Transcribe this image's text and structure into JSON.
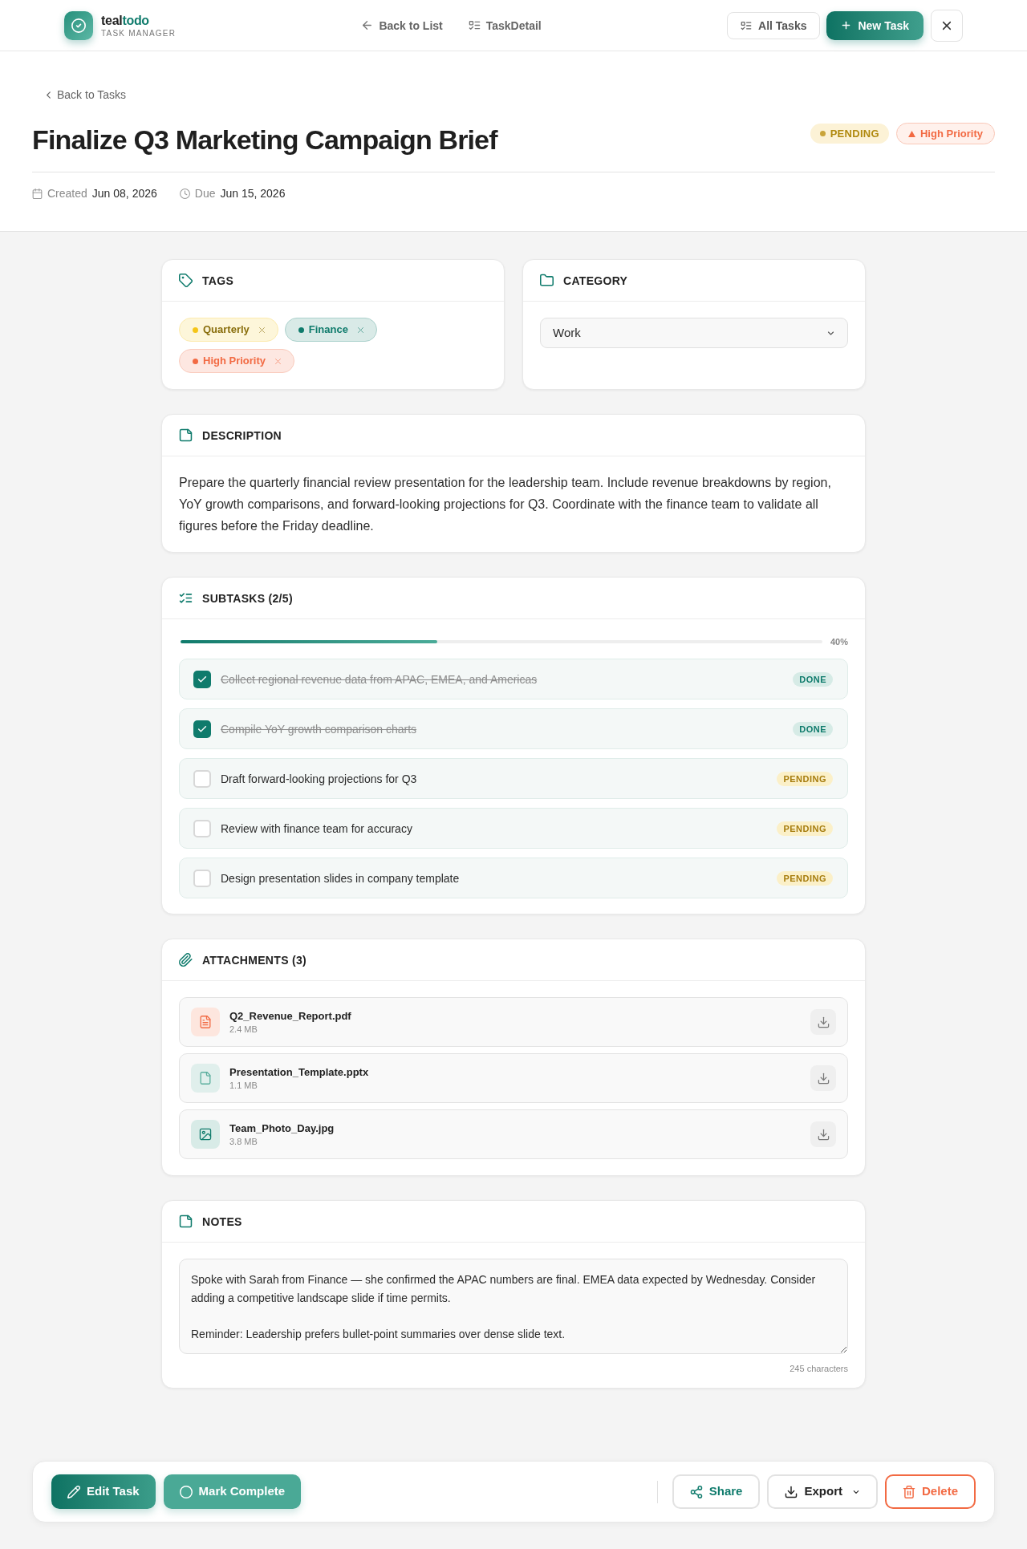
{
  "header": {
    "brand": {
      "name_start": "teal",
      "name_end": "todo",
      "subtitle": "TASK MANAGER"
    },
    "nav": [
      {
        "kind": "back",
        "label": "Back to List"
      },
      {
        "kind": "list",
        "label": "TaskDetail"
      }
    ],
    "all_tasks_button": {
      "label": "All Tasks"
    },
    "new_task_button": {
      "label": "New Task"
    }
  },
  "task": {
    "back_link": "Back to Tasks",
    "title": "Finalize Q3 Marketing Campaign Brief",
    "status_badge": "PENDING",
    "priority_badge": "High Priority",
    "meta": [
      {
        "kind": "created",
        "label": "Created",
        "value": "Jun 08, 2026"
      },
      {
        "kind": "due",
        "label": "Due",
        "value": "Jun 15, 2026"
      }
    ]
  },
  "tags": {
    "title": "TAGS",
    "items": [
      {
        "label": "Quarterly",
        "color": "#f5c518"
      },
      {
        "label": "Finance",
        "color": "#0f7b6c"
      },
      {
        "label": "High Priority",
        "color": "#f26a43"
      }
    ]
  },
  "category": {
    "title": "CATEGORY",
    "value": "Work"
  },
  "description": {
    "title": "DESCRIPTION",
    "text": "Prepare the quarterly financial review presentation for the leadership team. Include revenue breakdowns by region, YoY growth comparisons, and forward-looking projections for Q3. Coordinate with the finance team to validate all figures before the Friday deadline."
  },
  "subtasks": {
    "title": "SUBTASKS (2/5)",
    "progress": {
      "level": 0.4,
      "reading": "40%"
    },
    "items": [
      {
        "text": "Collect regional revenue data from APAC, EMEA, and Americas",
        "checked": true,
        "status": "DONE"
      },
      {
        "text": "Compile YoY growth comparison charts",
        "checked": true,
        "status": "DONE"
      },
      {
        "text": "Draft forward-looking projections for Q3",
        "checked": false,
        "status": "PENDING"
      },
      {
        "text": "Review with finance team for accuracy",
        "checked": false,
        "status": "PENDING"
      },
      {
        "text": "Design presentation slides in company template",
        "checked": false,
        "status": "PENDING"
      }
    ]
  },
  "attachments": {
    "title": "ATTACHMENTS (3)",
    "items": [
      {
        "kind": "pdf",
        "name": "Q2_Revenue_Report.pdf",
        "size": "2.4 MB"
      },
      {
        "kind": "file",
        "name": "Presentation_Template.pptx",
        "size": "1.1 MB"
      },
      {
        "kind": "image",
        "name": "Team_Photo_Day.jpg",
        "size": "3.8 MB"
      }
    ]
  },
  "notes": {
    "title": "NOTES",
    "value": "Spoke with Sarah from Finance — she confirmed the APAC numbers are final. EMEA data expected by Wednesday. Consider adding a competitive landscape slide if time permits.\n\nReminder: Leadership prefers bullet-point summaries over dense slide text.",
    "count": "245 characters"
  },
  "action_bar": {
    "edit_button": {
      "label": "Edit Task"
    },
    "complete_button": {
      "label": "Mark Complete"
    },
    "share_button": {
      "label": "Share"
    },
    "export_button": {
      "label": "Export"
    },
    "delete_button": {
      "label": "Delete"
    }
  }
}
